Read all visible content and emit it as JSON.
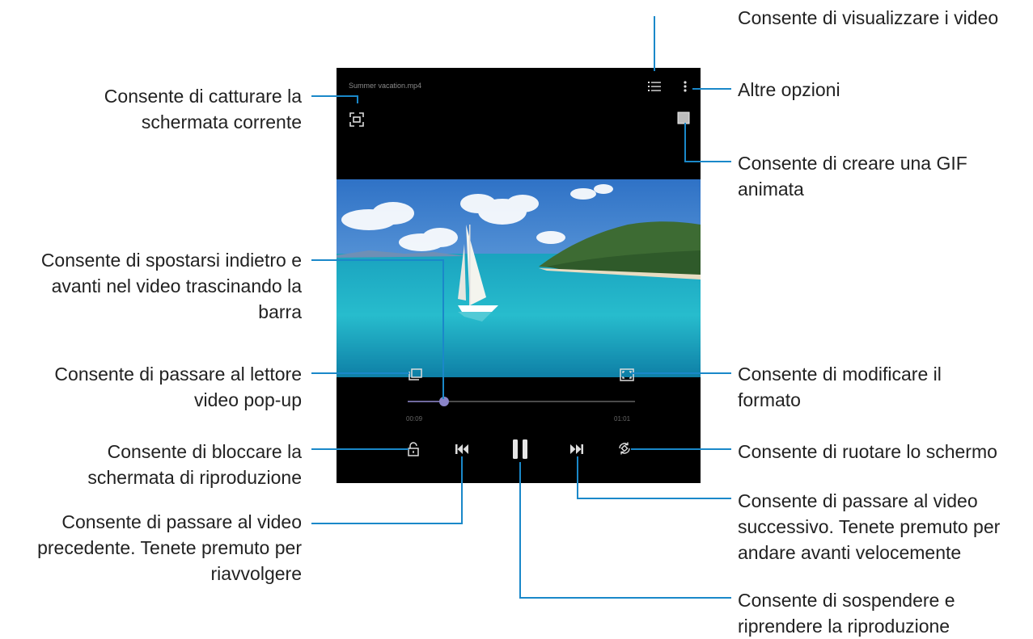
{
  "player": {
    "video_title": "Summer vacation.mp4",
    "time_elapsed": "00:09",
    "time_total": "01:01",
    "progress": 0.16,
    "accent_color": "#8a84c8",
    "icons": {
      "capture": "screen-capture-icon",
      "playlist": "playlist-icon",
      "more": "more-options-icon",
      "gif": "gif-icon",
      "popup": "popup-player-icon",
      "ratio": "screen-ratio-icon",
      "lock": "lock-icon",
      "previous": "previous-icon",
      "pause": "pause-icon",
      "next": "next-icon",
      "rotate": "rotate-icon"
    }
  },
  "callouts": {
    "visualizza_video": "Consente di visualizzare i video",
    "altre_opzioni": "Altre opzioni",
    "catturare": "Consente di catturare la\nschermata corrente",
    "gif": "Consente di creare una GIF\nanimata",
    "spostarsi": "Consente di spostarsi indietro e\navanti nel video trascinando la\nbarra",
    "popup": "Consente di passare al lettore\nvideo pop-up",
    "formato": "Consente di modificare il\nformato",
    "bloccare": "Consente di bloccare la\nschermata di riproduzione",
    "ruotare": "Consente di ruotare lo schermo",
    "precedente": "Consente di passare al video\nprecedente. Tenete premuto per\nriavvolgere",
    "successivo": "Consente di passare al video\nsuccessivo. Tenete premuto per\nandare avanti velocemente",
    "sospendere": "Consente di sospendere e\nriprendere la riproduzione"
  },
  "line_color": "#1a88c9"
}
